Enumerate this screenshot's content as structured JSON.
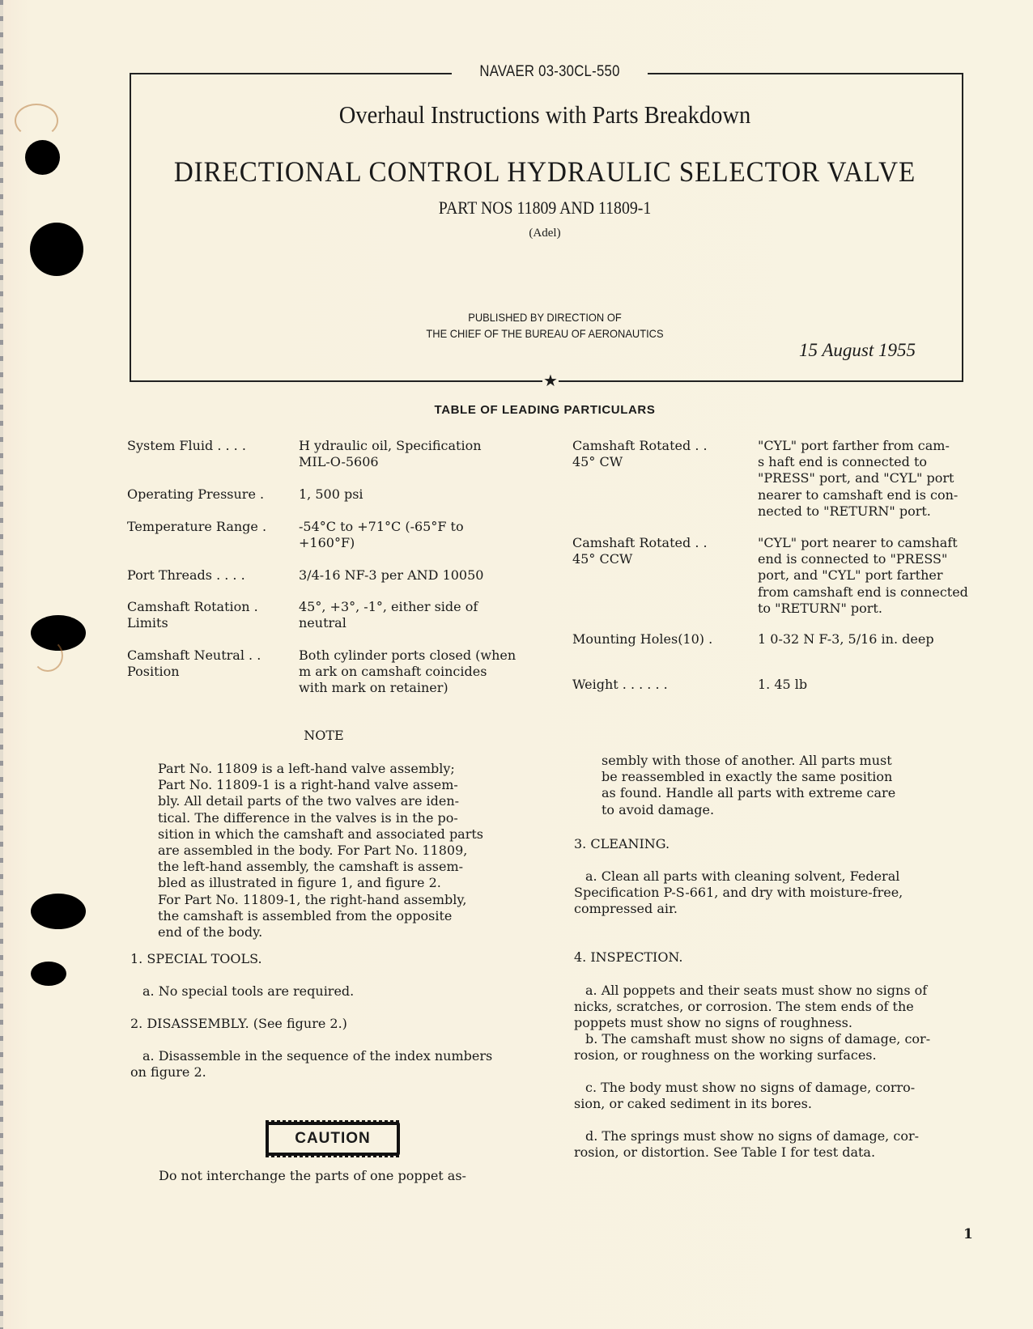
{
  "document": {
    "doc_number": "NAVAER 03-30CL-550",
    "overhaul_title": "Overhaul Instructions with Parts Breakdown",
    "main_title": "DIRECTIONAL CONTROL HYDRAULIC SELECTOR VALVE",
    "part_nos": "PART NOS 11809 AND 11809-1",
    "manufacturer": "(Adel)",
    "published_line1": "PUBLISHED BY DIRECTION OF",
    "published_line2": "THE CHIEF OF THE BUREAU OF AERONAUTICS",
    "date": "15 August 1955",
    "star_icon": "★",
    "page_number": "1"
  },
  "particulars": {
    "title": "TABLE OF LEADING PARTICULARS",
    "left": [
      {
        "label": [
          "System Fluid . . . ."
        ],
        "value": [
          "H ydraulic oil, Specification",
          "MIL-O-5606"
        ]
      },
      {
        "label": [
          "Operating Pressure ."
        ],
        "value": [
          "1, 500 psi"
        ]
      },
      {
        "label": [
          "Temperature Range ."
        ],
        "value": [
          "-54°C to +71°C  (-65°F to",
          "+160°F)"
        ]
      },
      {
        "label": [
          "Port Threads . . . ."
        ],
        "value": [
          "3/4-16 NF-3 per AND 10050"
        ]
      },
      {
        "label": [
          "Camshaft Rotation  .",
          "Limits"
        ],
        "value": [
          "45°, +3°, -1°, either side of",
          "neutral"
        ]
      },
      {
        "label": [
          "Camshaft Neutral . .",
          "Position"
        ],
        "value": [
          "Both cylinder ports closed (when",
          "m ark on camshaft coincides",
          "with mark on retainer)"
        ]
      }
    ],
    "right": [
      {
        "label": [
          "Camshaft Rotated . .",
          "45° CW"
        ],
        "value": [
          "\"CYL\" port farther from cam-",
          "s haft  end  is  connected  to",
          "\"PRESS\" port, and \"CYL\" port",
          "nearer to camshaft end is con-",
          "nected to \"RETURN\" port."
        ]
      },
      {
        "label": [
          "Camshaft Rotated . .",
          "45° CCW"
        ],
        "value": [
          "\"CYL\" port nearer to camshaft",
          "end is connected to \"PRESS\"",
          "port, and \"CYL\" port farther",
          "from camshaft end is connected",
          "to \"RETURN\" port."
        ]
      },
      {
        "label": [
          "Mounting Holes(10)  ."
        ],
        "value": [
          "1 0-32 N F-3,  5/16 in. deep"
        ]
      },
      {
        "label": [
          "Weight   . . . . . ."
        ],
        "value": [
          "1. 45 lb"
        ]
      }
    ]
  },
  "note": {
    "title": "NOTE",
    "lines": [
      "Part No. 11809 is a left-hand valve assembly;",
      "Part No. 11809-1 is a right-hand valve assem-",
      "bly.  All detail parts of the two valves are iden-",
      "tical.  The difference in the valves is in the po-",
      "sition in which the camshaft and associated parts",
      "are assembled in the body.  For Part No. 11809,",
      "the left-hand assembly, the camshaft is assem-",
      "bled as illustrated in figure 1, and figure 2.",
      "For Part No. 11809-1, the right-hand assembly,",
      "the camshaft is assembled from the opposite",
      "end of the body."
    ]
  },
  "sections": {
    "special_tools": {
      "heading": "1.  SPECIAL TOOLS.",
      "item_a": "a.  No special tools are required."
    },
    "disassembly": {
      "heading": "2.  DISASSEMBLY.  (See figure 2.)",
      "item_a_line1": "a.  Disassemble in the sequence of the index numbers",
      "item_a_line2": "on figure 2.",
      "caution_label": "CAUTION",
      "caution_line1": "Do not interchange the parts of one poppet as-",
      "caution_continued": [
        "sembly with those of another.  All parts must",
        "be reassembled in exactly the same position",
        "as found.  Handle all parts with extreme care",
        "to avoid damage."
      ]
    },
    "cleaning": {
      "heading": "3.  CLEANING.",
      "item_a": [
        "a.  Clean all parts with cleaning solvent, Federal",
        "Specification P-S-661, and dry with moisture-free,",
        "compressed air."
      ]
    },
    "inspection": {
      "heading": "4.  INSPECTION.",
      "item_a": [
        "a.  All poppets and their seats must show no signs of",
        "nicks, scratches, or corrosion.  The stem ends of the",
        "poppets must show no signs of roughness."
      ],
      "item_b": [
        "b.  The camshaft must show no signs of damage, cor-",
        "rosion, or roughness on the working surfaces."
      ],
      "item_c": [
        "c.  The body must show no signs of damage, corro-",
        "sion, or caked sediment in its bores."
      ],
      "item_d": [
        "d.  The springs must show no signs of damage, cor-",
        "rosion, or distortion.  See Table I for test data."
      ]
    }
  }
}
